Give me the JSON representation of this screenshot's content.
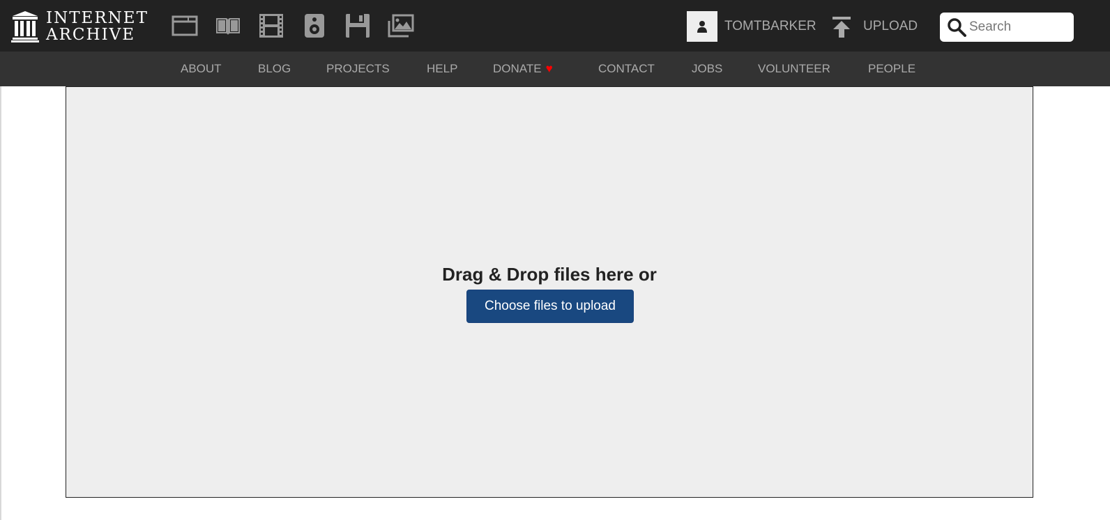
{
  "logo": {
    "line1": "INTERNET",
    "line2": "ARCHIVE"
  },
  "media_icons": [
    "web-icon",
    "texts-icon",
    "video-icon",
    "audio-icon",
    "software-icon",
    "images-icon"
  ],
  "user": {
    "username": "TOMTBARKER"
  },
  "upload": {
    "label": "UPLOAD"
  },
  "search": {
    "placeholder": "Search"
  },
  "nav": {
    "about": "ABOUT",
    "blog": "BLOG",
    "projects": "PROJECTS",
    "help": "HELP",
    "donate": "DONATE",
    "contact": "CONTACT",
    "jobs": "JOBS",
    "volunteer": "VOLUNTEER",
    "people": "PEOPLE"
  },
  "dropzone": {
    "text": "Drag & Drop files here or",
    "button_label": "Choose files to upload"
  },
  "colors": {
    "topbar": "#222222",
    "navbar": "#333333",
    "nav_text": "#aaaaaa",
    "dropzone_bg": "#eeeeee",
    "button_bg": "#194880",
    "heart": "#ff0000"
  }
}
